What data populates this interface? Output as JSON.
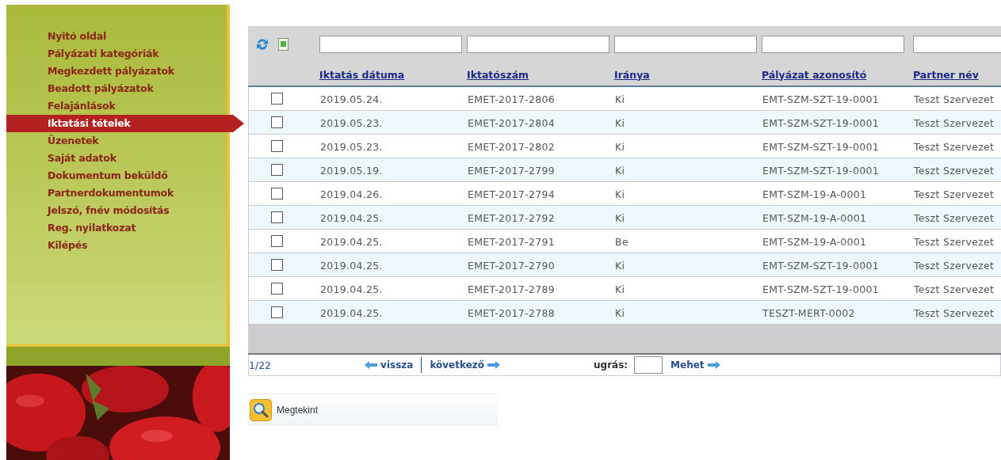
{
  "sidebar": {
    "items": [
      {
        "label": "Nyitó oldal",
        "selected": false
      },
      {
        "label": "Pályázati kategóriák",
        "selected": false
      },
      {
        "label": "Megkezdett pályázatok",
        "selected": false
      },
      {
        "label": "Beadott pályázatok",
        "selected": false
      },
      {
        "label": "Felajánlások",
        "selected": false
      },
      {
        "label": "Iktatási tételek",
        "selected": true
      },
      {
        "label": "Üzenetek",
        "selected": false
      },
      {
        "label": "Saját adatok",
        "selected": false
      },
      {
        "label": "Dokumentum beküldő",
        "selected": false
      },
      {
        "label": "Partnerdokumentumok",
        "selected": false
      },
      {
        "label": "Jelszó, fnév módosítás",
        "selected": false
      },
      {
        "label": "Reg. nyilatkozat",
        "selected": false
      },
      {
        "label": "Kilépés",
        "selected": false
      }
    ]
  },
  "table": {
    "columns": [
      "Iktatás dátuma",
      "Iktatószám",
      "Iránya",
      "Pályázat azonosító",
      "Partner név"
    ],
    "rows": [
      {
        "checked": false,
        "cells": [
          "2019.05.24.",
          "EMET-2017-2806",
          "Ki",
          "EMT-SZM-SZT-19-0001",
          "Teszt Szervezet"
        ]
      },
      {
        "checked": false,
        "cells": [
          "2019.05.23.",
          "EMET-2017-2804",
          "Ki",
          "EMT-SZM-SZT-19-0001",
          "Teszt Szervezet"
        ]
      },
      {
        "checked": false,
        "cells": [
          "2019.05.23.",
          "EMET-2017-2802",
          "Ki",
          "EMT-SZM-SZT-19-0001",
          "Teszt Szervezet"
        ]
      },
      {
        "checked": false,
        "cells": [
          "2019.05.19.",
          "EMET-2017-2799",
          "Ki",
          "EMT-SZM-SZT-19-0001",
          "Teszt Szervezet"
        ]
      },
      {
        "checked": false,
        "cells": [
          "2019.04.26.",
          "EMET-2017-2794",
          "Ki",
          "EMT-SZM-19-A-0001",
          "Teszt Szervezet"
        ]
      },
      {
        "checked": false,
        "cells": [
          "2019.04.25.",
          "EMET-2017-2792",
          "Ki",
          "EMT-SZM-19-A-0001",
          "Teszt Szervezet"
        ]
      },
      {
        "checked": false,
        "cells": [
          "2019.04.25.",
          "EMET-2017-2791",
          "Be",
          "EMT-SZM-19-A-0001",
          "Teszt Szervezet"
        ]
      },
      {
        "checked": false,
        "cells": [
          "2019.04.25.",
          "EMET-2017-2790",
          "Ki",
          "EMT-SZM-SZT-19-0001",
          "Teszt Szervezet"
        ]
      },
      {
        "checked": false,
        "cells": [
          "2019.04.25.",
          "EMET-2017-2789",
          "Ki",
          "EMT-SZM-SZT-19-0001",
          "Teszt Szervezet"
        ]
      },
      {
        "checked": false,
        "cells": [
          "2019.04.25.",
          "EMET-2017-2788",
          "Ki",
          "TESZT-MERT-0002",
          "Teszt Szervezet"
        ]
      }
    ]
  },
  "pagination": {
    "page": "1/22",
    "previous": "vissza",
    "next": "következő",
    "jump_label": "ugrás:",
    "go": "Mehet"
  },
  "actions": [
    {
      "label": "Megtekint"
    }
  ]
}
